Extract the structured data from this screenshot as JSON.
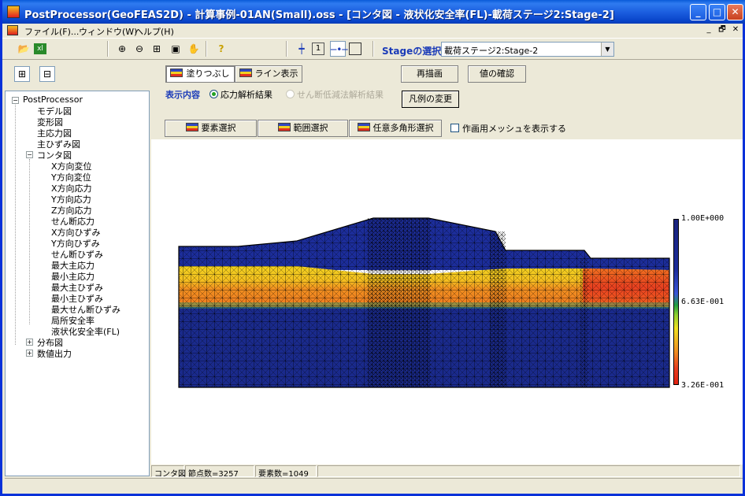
{
  "window": {
    "title": "PostProcessor(GeoFEAS2D) - 計算事例-01AN(Small).oss - [コンタ図 - 液状化安全率(FL)-載荷ステージ2:Stage-2]"
  },
  "titlebar_buttons": {
    "minimize": "_",
    "maximize": "□",
    "close": "✕"
  },
  "menu": {
    "items": [
      "ファイル(F)...",
      "ウィンドウ(W)",
      "ヘルプ(H)"
    ],
    "mdi_min": "_",
    "mdi_restore": "🗗",
    "mdi_close": "✕"
  },
  "toolbar": {
    "stage_label": "Stageの選択",
    "stage_value": "載荷ステージ2:Stage-2",
    "icons": [
      "open-icon",
      "export-icon",
      "zoom-in-icon",
      "zoom-out-icon",
      "fit-icon",
      "window-icon",
      "pan-icon",
      "help-icon",
      "node-icon",
      "number-icon",
      "element-icon",
      "rect-icon"
    ]
  },
  "tree": {
    "root": "PostProcessor",
    "level1": [
      {
        "label": "モデル図"
      },
      {
        "label": "変形図"
      },
      {
        "label": "主応力図"
      },
      {
        "label": "主ひずみ図"
      },
      {
        "label": "コンタ図",
        "children": [
          "X方向変位",
          "Y方向変位",
          "X方向応力",
          "Y方向応力",
          "Z方向応力",
          "せん断応力",
          "X方向ひずみ",
          "Y方向ひずみ",
          "せん断ひずみ",
          "最大主応力",
          "最小主応力",
          "最大主ひずみ",
          "最小主ひずみ",
          "最大せん断ひずみ",
          "局所安全率",
          "液状化安全率(FL)"
        ]
      },
      {
        "label": "分布図"
      },
      {
        "label": "数値出力"
      }
    ]
  },
  "controls": {
    "fill_button": "塗りつぶし",
    "line_button": "ライン表示",
    "redraw_button": "再描画",
    "check_value_button": "値の確認",
    "display_label": "表示内容",
    "radio_stress": "応力解析結果",
    "radio_shear": "せん断低減法解析結果",
    "legend_change_button": "凡例の変更",
    "element_select_button": "要素選択",
    "range_select_button": "範囲選択",
    "polygon_select_button": "任意多角形選択",
    "show_mesh_checkbox": "作画用メッシュを表示する"
  },
  "legend": {
    "max_label": "1.00E+000",
    "mid_label": "6.63E-001",
    "min_label": "3.26E-001",
    "colors": [
      "#1a237e",
      "#20a040",
      "#f0e020",
      "#e02010"
    ]
  },
  "statusbar": {
    "mode": "コンタ図",
    "nodes": "節点数=3257",
    "elements": "要素数=1049"
  }
}
